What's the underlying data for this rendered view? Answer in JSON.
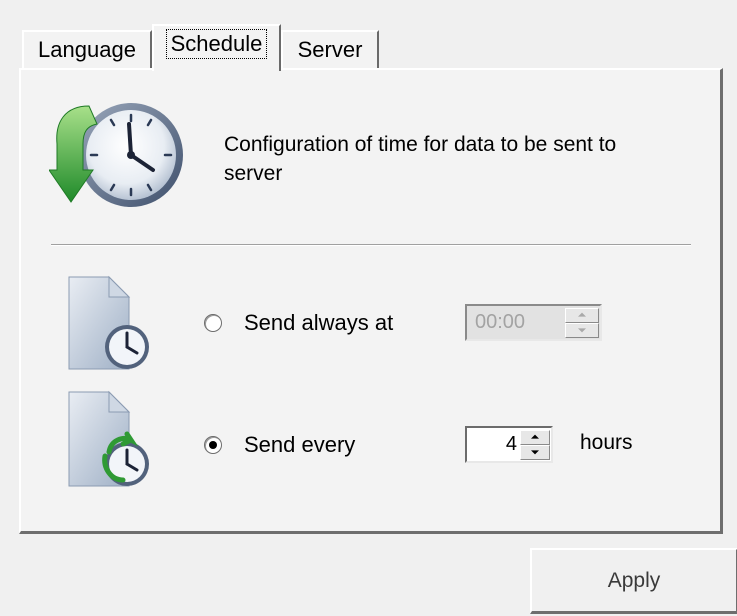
{
  "tabs": [
    {
      "label": "Language",
      "active": false
    },
    {
      "label": "Schedule",
      "active": true
    },
    {
      "label": "Server",
      "active": false
    }
  ],
  "header": {
    "icon": "clock-arrow-icon",
    "description": "Configuration of time for data to be sent to server"
  },
  "options": {
    "send_always": {
      "icon": "document-clock-icon",
      "label": "Send always at",
      "selected": false,
      "value": "00:00",
      "enabled": false
    },
    "send_every": {
      "icon": "document-clock-refresh-icon",
      "label": "Send every",
      "selected": true,
      "value": "4",
      "unit": "hours",
      "enabled": true
    }
  },
  "actions": {
    "apply_label": "Apply"
  },
  "colors": {
    "background": "#f0f0f0",
    "arrow_green": "#3aa23a",
    "clock_blue": "#4f6fa3"
  }
}
